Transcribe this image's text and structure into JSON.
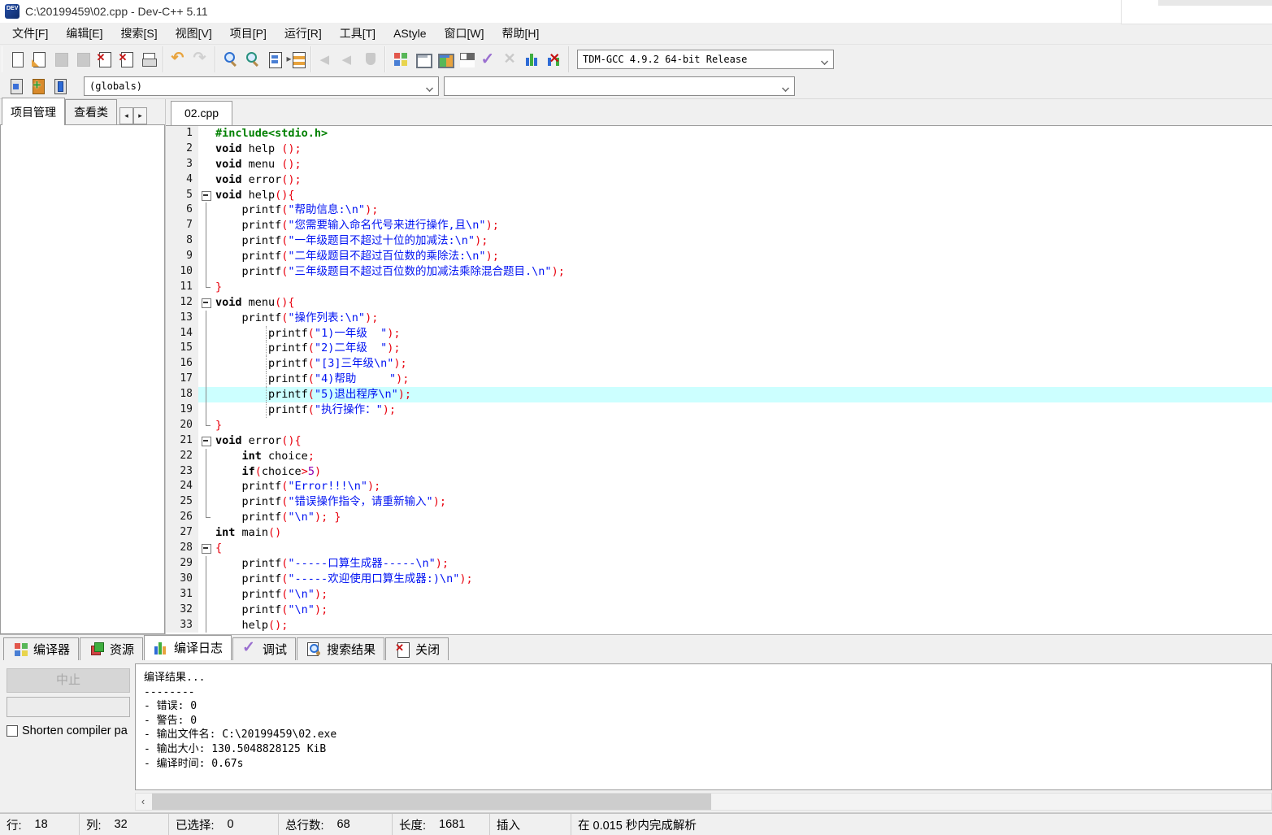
{
  "window": {
    "title": "C:\\20199459\\02.cpp - Dev-C++ 5.11"
  },
  "menu": {
    "items": [
      "文件[F]",
      "编辑[E]",
      "搜索[S]",
      "视图[V]",
      "项目[P]",
      "运行[R]",
      "工具[T]",
      "AStyle",
      "窗口[W]",
      "帮助[H]"
    ]
  },
  "toolbar": {
    "compiler_combo_value": "TDM-GCC 4.9.2 64-bit Release",
    "globals_combo_value": "(globals)",
    "row1_groups": [
      {
        "items": [
          {
            "name": "new-file-icon",
            "cls": "new-file-icon"
          },
          {
            "name": "open-file-icon",
            "cls": "open-file-icon"
          },
          {
            "name": "save-icon",
            "cls": "save-icon",
            "disabled": true
          },
          {
            "name": "save-all-icon",
            "cls": "save-all-icon",
            "disabled": true
          },
          {
            "name": "close-file-icon",
            "cls": "close-file-icon"
          },
          {
            "name": "close-all-icon",
            "cls": "close-all-icon"
          },
          {
            "name": "print-icon",
            "cls": "print-icon"
          }
        ]
      },
      {
        "items": [
          {
            "name": "undo-icon",
            "cls": "undo-icon"
          },
          {
            "name": "redo-icon",
            "cls": "redo-icon",
            "disabled": true
          }
        ]
      },
      {
        "items": [
          {
            "name": "find-icon",
            "cls": "mag"
          },
          {
            "name": "find-in-files-icon",
            "cls": "mag find-in-files-icon"
          },
          {
            "name": "replace-icon",
            "cls": "replace-icon"
          },
          {
            "name": "swap-header-source-icon",
            "cls": "swap-header-source-icon"
          }
        ]
      },
      {
        "items": [
          {
            "name": "back-icon",
            "cls": "back-icon",
            "disabled": true
          },
          {
            "name": "forward-icon",
            "cls": "forward-icon",
            "disabled": true
          },
          {
            "name": "toggle-breakpoint-icon",
            "cls": "toggle-breakpoint-icon",
            "disabled": true
          }
        ]
      },
      {
        "items": [
          {
            "name": "compile-icon",
            "cls": "grid4"
          },
          {
            "name": "run-icon",
            "cls": "run-icon"
          },
          {
            "name": "compile-run-icon",
            "cls": "compile-run-icon"
          },
          {
            "name": "rebuild-icon",
            "cls": "grid4 rebuild-icon"
          },
          {
            "name": "syntax-check-icon",
            "cls": "syntax-check-icon"
          },
          {
            "name": "abort-compile-icon",
            "cls": "abort-compile-icon",
            "disabled": true
          },
          {
            "name": "profile-icon",
            "cls": "bars"
          },
          {
            "name": "delete-profile-icon",
            "cls": "delete-profile-icon"
          }
        ]
      }
    ],
    "row2_items": [
      {
        "name": "new-unit-icon",
        "cls": "new-unit-icon"
      },
      {
        "name": "add-to-project-icon",
        "cls": "add-to-project-icon"
      },
      {
        "name": "remove-from-project-icon",
        "cls": "remove-from-project-icon"
      }
    ]
  },
  "left_panel": {
    "tabs": [
      {
        "label": "项目管理",
        "active": true
      },
      {
        "label": "查看类",
        "active": false
      }
    ],
    "arrow_left": "◂",
    "arrow_right": "▸"
  },
  "editor": {
    "tab_label": "02.cpp",
    "lines": [
      {
        "n": 1,
        "fold": "none",
        "toks": [
          [
            "g",
            "#include<stdio.h>"
          ]
        ]
      },
      {
        "n": 2,
        "fold": "none",
        "toks": [
          [
            "k",
            "void"
          ],
          [
            "p",
            " help "
          ],
          [
            "y",
            "();"
          ]
        ]
      },
      {
        "n": 3,
        "fold": "none",
        "toks": [
          [
            "k",
            "void"
          ],
          [
            "p",
            " menu "
          ],
          [
            "y",
            "();"
          ]
        ]
      },
      {
        "n": 4,
        "fold": "none",
        "toks": [
          [
            "k",
            "void"
          ],
          [
            "p",
            " error"
          ],
          [
            "y",
            "();"
          ]
        ]
      },
      {
        "n": 5,
        "fold": "box",
        "toks": [
          [
            "k",
            "void"
          ],
          [
            "p",
            " help"
          ],
          [
            "y",
            "(){"
          ]
        ]
      },
      {
        "n": 6,
        "fold": "line",
        "toks": [
          [
            "p",
            "    printf"
          ],
          [
            "y",
            "("
          ],
          [
            "s",
            "\"帮助信息:\\n\""
          ],
          [
            "y",
            ");"
          ]
        ]
      },
      {
        "n": 7,
        "fold": "line",
        "toks": [
          [
            "p",
            "    printf"
          ],
          [
            "y",
            "("
          ],
          [
            "s",
            "\"您需要输入命名代号来进行操作,且\\n\""
          ],
          [
            "y",
            ");"
          ]
        ]
      },
      {
        "n": 8,
        "fold": "line",
        "toks": [
          [
            "p",
            "    printf"
          ],
          [
            "y",
            "("
          ],
          [
            "s",
            "\"一年级题目不超过十位的加减法:\\n\""
          ],
          [
            "y",
            ");"
          ]
        ]
      },
      {
        "n": 9,
        "fold": "line",
        "toks": [
          [
            "p",
            "    printf"
          ],
          [
            "y",
            "("
          ],
          [
            "s",
            "\"二年级题目不超过百位数的乘除法:\\n\""
          ],
          [
            "y",
            ");"
          ]
        ]
      },
      {
        "n": 10,
        "fold": "line",
        "toks": [
          [
            "p",
            "    printf"
          ],
          [
            "y",
            "("
          ],
          [
            "s",
            "\"三年级题目不超过百位数的加减法乘除混合题目.\\n\""
          ],
          [
            "y",
            ");"
          ]
        ]
      },
      {
        "n": 11,
        "fold": "end",
        "toks": [
          [
            "y",
            "}"
          ]
        ]
      },
      {
        "n": 12,
        "fold": "box",
        "toks": [
          [
            "k",
            "void"
          ],
          [
            "p",
            " menu"
          ],
          [
            "y",
            "(){"
          ]
        ]
      },
      {
        "n": 13,
        "fold": "line",
        "toks": [
          [
            "p",
            "    printf"
          ],
          [
            "y",
            "("
          ],
          [
            "s",
            "\"操作列表:\\n\""
          ],
          [
            "y",
            ");"
          ]
        ]
      },
      {
        "n": 14,
        "fold": "line",
        "guide": true,
        "toks": [
          [
            "p",
            "        printf"
          ],
          [
            "y",
            "("
          ],
          [
            "s",
            "\"1)一年级  \""
          ],
          [
            "y",
            ");"
          ]
        ]
      },
      {
        "n": 15,
        "fold": "line",
        "guide": true,
        "toks": [
          [
            "p",
            "        printf"
          ],
          [
            "y",
            "("
          ],
          [
            "s",
            "\"2)二年级  \""
          ],
          [
            "y",
            ");"
          ]
        ]
      },
      {
        "n": 16,
        "fold": "line",
        "guide": true,
        "toks": [
          [
            "p",
            "        printf"
          ],
          [
            "y",
            "("
          ],
          [
            "s",
            "\"[3]三年级\\n\""
          ],
          [
            "y",
            ");"
          ]
        ]
      },
      {
        "n": 17,
        "fold": "line",
        "guide": true,
        "toks": [
          [
            "p",
            "        printf"
          ],
          [
            "y",
            "("
          ],
          [
            "s",
            "\"4)帮助     \""
          ],
          [
            "y",
            ");"
          ]
        ]
      },
      {
        "n": 18,
        "fold": "line",
        "guide": true,
        "hl": true,
        "toks": [
          [
            "p",
            "        printf"
          ],
          [
            "y",
            "("
          ],
          [
            "s",
            "\"5)退出程序\\n\""
          ],
          [
            "y",
            ");"
          ]
        ]
      },
      {
        "n": 19,
        "fold": "line",
        "guide": true,
        "toks": [
          [
            "p",
            "        printf"
          ],
          [
            "y",
            "("
          ],
          [
            "s",
            "\"执行操作：\""
          ],
          [
            "y",
            ");"
          ]
        ]
      },
      {
        "n": 20,
        "fold": "end",
        "toks": [
          [
            "y",
            "}"
          ]
        ]
      },
      {
        "n": 21,
        "fold": "box",
        "toks": [
          [
            "k",
            "void"
          ],
          [
            "p",
            " error"
          ],
          [
            "y",
            "(){"
          ]
        ]
      },
      {
        "n": 22,
        "fold": "line",
        "toks": [
          [
            "p",
            "    "
          ],
          [
            "k",
            "int"
          ],
          [
            "p",
            " choice"
          ],
          [
            "y",
            ";"
          ]
        ]
      },
      {
        "n": 23,
        "fold": "line",
        "toks": [
          [
            "p",
            "    "
          ],
          [
            "k",
            "if"
          ],
          [
            "y",
            "("
          ],
          [
            "p",
            "choice"
          ],
          [
            "y",
            ">"
          ],
          [
            "n",
            "5"
          ],
          [
            "y",
            ")"
          ]
        ]
      },
      {
        "n": 24,
        "fold": "line",
        "toks": [
          [
            "p",
            "    printf"
          ],
          [
            "y",
            "("
          ],
          [
            "s",
            "\"Error!!!\\n\""
          ],
          [
            "y",
            ");"
          ]
        ]
      },
      {
        "n": 25,
        "fold": "line",
        "toks": [
          [
            "p",
            "    printf"
          ],
          [
            "y",
            "("
          ],
          [
            "s",
            "\"错误操作指令，请重新输入\""
          ],
          [
            "y",
            ");"
          ]
        ]
      },
      {
        "n": 26,
        "fold": "end",
        "toks": [
          [
            "p",
            "    printf"
          ],
          [
            "y",
            "("
          ],
          [
            "s",
            "\"\\n\""
          ],
          [
            "y",
            "); }"
          ]
        ]
      },
      {
        "n": 27,
        "fold": "none",
        "toks": [
          [
            "k",
            "int"
          ],
          [
            "p",
            " main"
          ],
          [
            "y",
            "()"
          ]
        ]
      },
      {
        "n": 28,
        "fold": "box",
        "toks": [
          [
            "y",
            "{"
          ]
        ]
      },
      {
        "n": 29,
        "fold": "line",
        "toks": [
          [
            "p",
            "    printf"
          ],
          [
            "y",
            "("
          ],
          [
            "s",
            "\"-----口算生成器-----\\n\""
          ],
          [
            "y",
            ");"
          ]
        ]
      },
      {
        "n": 30,
        "fold": "line",
        "toks": [
          [
            "p",
            "    printf"
          ],
          [
            "y",
            "("
          ],
          [
            "s",
            "\"-----欢迎使用口算生成器:)\\n\""
          ],
          [
            "y",
            ");"
          ]
        ]
      },
      {
        "n": 31,
        "fold": "line",
        "toks": [
          [
            "p",
            "    printf"
          ],
          [
            "y",
            "("
          ],
          [
            "s",
            "\"\\n\""
          ],
          [
            "y",
            ");"
          ]
        ]
      },
      {
        "n": 32,
        "fold": "line",
        "toks": [
          [
            "p",
            "    printf"
          ],
          [
            "y",
            "("
          ],
          [
            "s",
            "\"\\n\""
          ],
          [
            "y",
            ");"
          ]
        ]
      },
      {
        "n": 33,
        "fold": "line",
        "toks": [
          [
            "p",
            "    help"
          ],
          [
            "y",
            "();"
          ]
        ]
      }
    ]
  },
  "bottom_tabs": [
    {
      "label": "编译器",
      "icon": "compiler-grid-icon",
      "cls": "grid4",
      "active": false
    },
    {
      "label": "资源",
      "icon": "resource-icon",
      "cls": "resource-icon",
      "active": false
    },
    {
      "label": "编译日志",
      "icon": "compile-log-icon",
      "cls": "compile-log-icon",
      "active": true
    },
    {
      "label": "调试",
      "icon": "debug-check-icon",
      "cls": "debug-check-icon",
      "active": false
    },
    {
      "label": "搜索结果",
      "icon": "search-results-icon",
      "cls": "search-results-icon",
      "active": false
    },
    {
      "label": "关闭",
      "icon": "close-tab-icon",
      "cls": "close-tab-icon",
      "active": false
    }
  ],
  "log_panel": {
    "abort_label": "中止",
    "shorten_label": "Shorten compiler pa",
    "lines": [
      "编译结果...",
      "--------",
      "- 错误: 0",
      "- 警告: 0",
      "- 输出文件名: C:\\20199459\\02.exe",
      "- 输出大小: 130.5048828125 KiB",
      "- 编译时间: 0.67s"
    ]
  },
  "scrollbar": {
    "left_arrow": "‹"
  },
  "status_bar": {
    "segments": [
      {
        "t": "行:",
        "v": "18"
      },
      {
        "t": "列:",
        "v": "32"
      },
      {
        "t": "已选择:",
        "v": "0"
      },
      {
        "t": "总行数:",
        "v": "68"
      },
      {
        "t": "长度:",
        "v": "1681"
      },
      {
        "t": "插入",
        "v": ""
      },
      {
        "t": "在 0.015 秒内完成解析",
        "v": ""
      }
    ]
  }
}
